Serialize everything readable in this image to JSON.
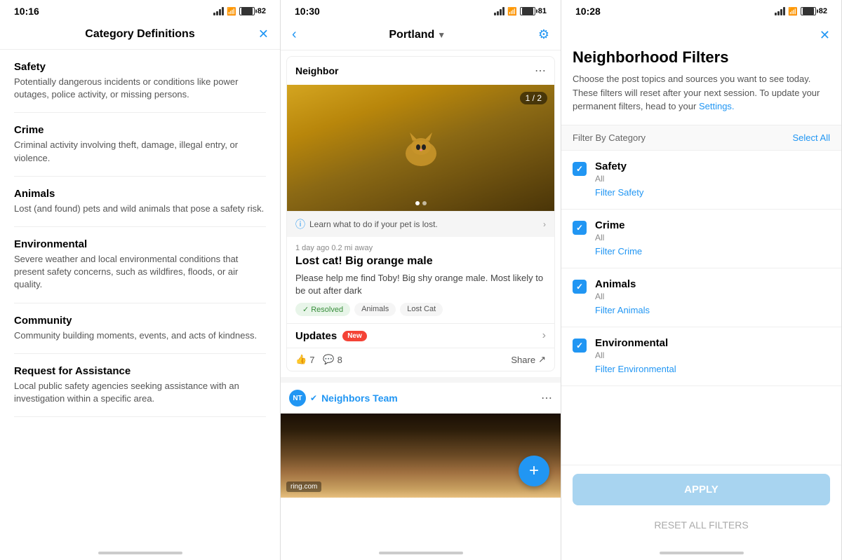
{
  "panel1": {
    "time": "10:16",
    "battery": "82",
    "title": "Category Definitions",
    "categories": [
      {
        "name": "Safety",
        "description": "Potentially dangerous incidents or conditions like power outages, police activity, or missing persons."
      },
      {
        "name": "Crime",
        "description": "Criminal activity involving theft, damage, illegal entry, or violence."
      },
      {
        "name": "Animals",
        "description": "Lost (and found) pets and wild animals that pose a safety risk."
      },
      {
        "name": "Environmental",
        "description": "Severe weather and local environmental conditions that present safety concerns, such as wildfires, floods, or air quality."
      },
      {
        "name": "Community",
        "description": "Community building moments, events, and acts of kindness."
      },
      {
        "name": "Request for Assistance",
        "description": "Local public safety agencies seeking assistance with an investigation within a specific area."
      }
    ]
  },
  "panel2": {
    "time": "10:30",
    "battery": "81",
    "location": "Portland",
    "post1": {
      "source": "Neighbor",
      "image_counter": "1 / 2",
      "info_text": "Learn what to do if your pet is lost.",
      "meta": "1 day ago  0.2 mi away",
      "title": "Lost cat!  Big orange male",
      "body": "Please help me find Toby!  Big shy orange male. Most likely to be out after dark",
      "tag_resolved": "Resolved",
      "tag_animals": "Animals",
      "tag_lostcat": "Lost Cat",
      "updates_label": "Updates",
      "new_badge": "New",
      "likes_count": "7",
      "comments_count": "8",
      "share_label": "Share"
    },
    "post2": {
      "poster": "Neighbors Team",
      "ring_watermark": "ring.com"
    }
  },
  "panel3": {
    "time": "10:28",
    "battery": "82",
    "title": "Neighborhood Filters",
    "description": "Choose the post topics and sources you want to see today. These filters will reset after your next session. To update your permanent filters, head to your",
    "settings_link": "Settings.",
    "filter_by_category": "Filter By Category",
    "select_all": "Select All",
    "filters": [
      {
        "name": "Safety",
        "sub": "All",
        "link": "Filter Safety",
        "checked": true
      },
      {
        "name": "Crime",
        "sub": "All",
        "link": "Filter Crime",
        "checked": true
      },
      {
        "name": "Animals",
        "sub": "All",
        "link": "Filter Animals",
        "checked": true
      },
      {
        "name": "Environmental",
        "sub": "All",
        "link": "Filter Environmental",
        "checked": true
      }
    ],
    "apply_label": "APPLY",
    "reset_label": "RESET ALL FILTERS"
  }
}
